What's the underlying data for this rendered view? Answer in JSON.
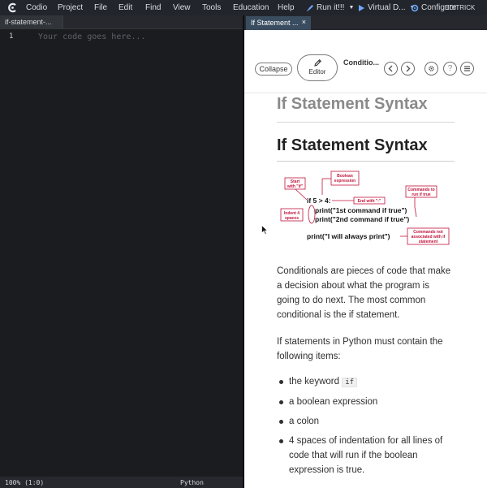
{
  "menubar": {
    "items": [
      "Codio",
      "Project",
      "File",
      "Edit",
      "Find",
      "View",
      "Tools",
      "Education",
      "Help"
    ],
    "run_label": "Run it!!!",
    "virtual_label": "Virtual D...",
    "configure_label": "Configure",
    "user_label": "EDITRICK",
    "icons": [
      "codio-logo-icon",
      "rocket-icon",
      "play-icon",
      "configure-icon"
    ]
  },
  "editor": {
    "tab_title": "if-statement-...",
    "line_number": "1",
    "placeholder": "Your code goes here...",
    "status_position": "100% (1:0)",
    "status_language": "Python"
  },
  "guide": {
    "tab_title": "If Statement ...",
    "tab_close": "×",
    "collapse_label": "Collapse",
    "editor_label": "Editor",
    "breadcrumb": "Conditio...",
    "help_label": "?",
    "ghost_heading": "If Statement Syntax",
    "heading": "If Statement Syntax",
    "diagram": {
      "code_lines": [
        "if 5 > 4:",
        "print(\"1st command if true\")",
        "print(\"2nd command if true\")",
        "print(\"I will always print\")"
      ],
      "callouts": {
        "start_line1": "Start",
        "start_line2": "with \"if\"",
        "boolean_line1": "Boolean",
        "boolean_line2": "expression",
        "end_with": "End with \":\"",
        "commands_line1": "Commands to",
        "commands_line2": "run if true",
        "indent_line1": "Indent 4",
        "indent_line2": "spaces",
        "not_assoc_line1": "Commands not",
        "not_assoc_line2": "associated with if",
        "not_assoc_line3": "statement"
      },
      "accent_color": "#c0143c"
    },
    "para1": "Conditionals are pieces of code that make a decision about what the program is going to do next. The most common conditional is the if statement.",
    "para2": "If statements in Python must contain the following items:",
    "bullets": {
      "b1_prefix": "the keyword",
      "b1_code": "if",
      "b2": "a boolean expression",
      "b3": "a colon",
      "b4": "4 spaces of indentation for all lines of code that will run if the boolean expression is true."
    }
  }
}
